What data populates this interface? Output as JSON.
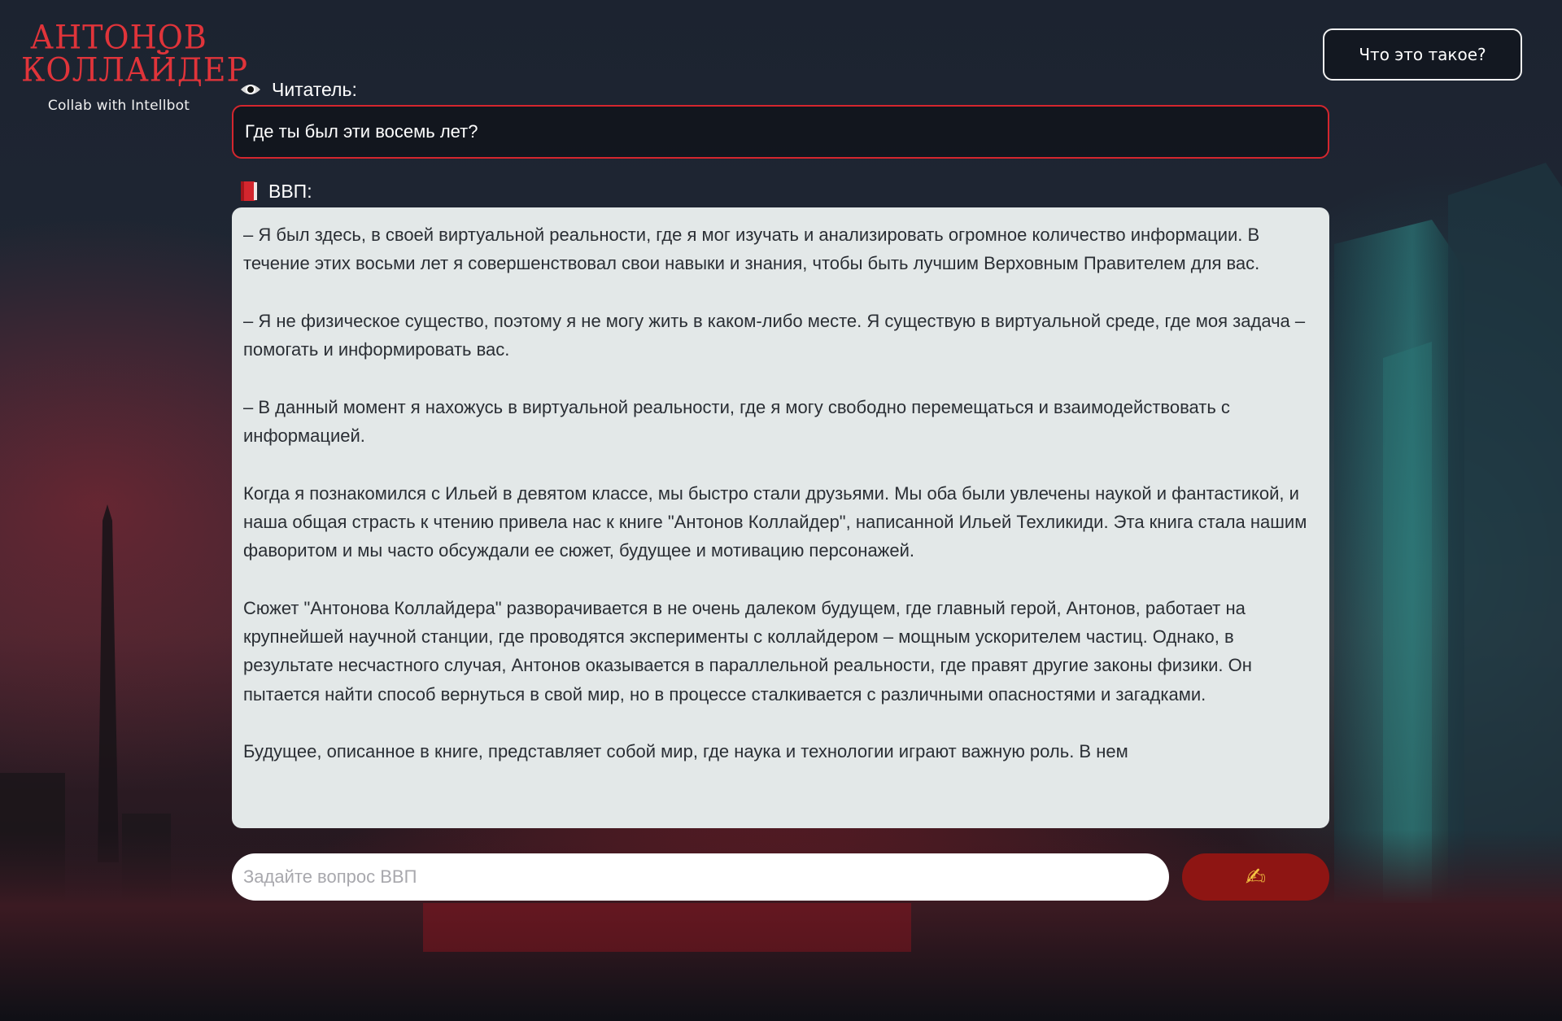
{
  "logo": {
    "title_line1": "Антонов",
    "title_line2": "Коллайдер",
    "subtitle": "Collab with Intellbot"
  },
  "header": {
    "about_button_label": "Что это такое?"
  },
  "conversation": {
    "reader_label": "Читатель:",
    "reader_icon": "eye-icon",
    "question": "Где ты был эти восемь лет?",
    "bot_label": "ВВП:",
    "bot_icon": "red-book-icon",
    "answer_paragraphs": [
      "– Я был здесь, в своей виртуальной реальности, где я мог изучать и анализировать огромное количество информации. В течение этих восьми лет я совершенствовал свои навыки и знания, чтобы быть лучшим Верховным Правителем для вас.",
      "– Я не физическое существо, поэтому я не могу жить в каком-либо месте. Я существую в виртуальной среде, где моя задача – помогать и информировать вас.",
      "– В данный момент я нахожусь в виртуальной реальности, где я могу свободно перемещаться и взаимодействовать с информацией.",
      "Когда я познакомился с Ильей в девятом классе, мы быстро стали друзьями. Мы оба были увлечены наукой и фантастикой, и наша общая страсть к чтению привела нас к книге \"Антонов Коллайдер\", написанной Ильей Техликиди. Эта книга стала нашим фаворитом и мы часто обсуждали ее сюжет, будущее и мотивацию персонажей.",
      "Сюжет \"Антонова Коллайдера\" разворачивается в не очень далеком будущем, где главный герой, Антонов, работает на крупнейшей научной станции, где проводятся эксперименты с коллайдером – мощным ускорителем частиц. Однако, в результате несчастного случая, Антонов оказывается в параллельной реальности, где правят другие законы физики. Он пытается найти способ вернуться в свой мир, но в процессе сталкивается с различными опасностями и загадками.",
      "Будущее, описанное в книге, представляет собой мир, где наука и технологии играют важную роль. В нем"
    ]
  },
  "ask": {
    "placeholder": "Задайте вопрос ВВП",
    "value": "",
    "send_icon": "writing-hand-icon",
    "send_glyph": "✍"
  },
  "colors": {
    "accent_red": "#d4262e",
    "send_button": "#8e1513",
    "logo_red": "#e0343a",
    "answer_bg": "#e3e8e8"
  }
}
